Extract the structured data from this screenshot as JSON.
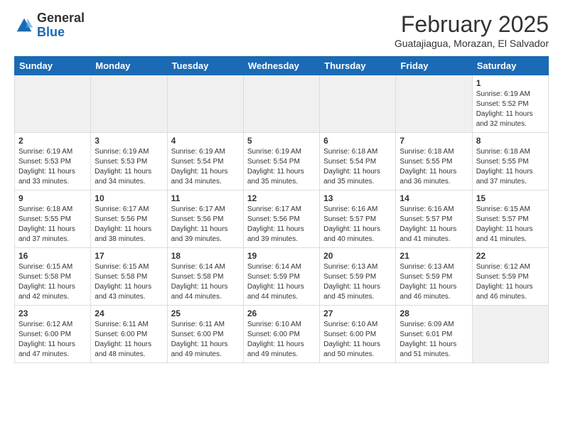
{
  "logo": {
    "general": "General",
    "blue": "Blue"
  },
  "header": {
    "month": "February 2025",
    "location": "Guatajiagua, Morazan, El Salvador"
  },
  "weekdays": [
    "Sunday",
    "Monday",
    "Tuesday",
    "Wednesday",
    "Thursday",
    "Friday",
    "Saturday"
  ],
  "weeks": [
    [
      {
        "day": "",
        "info": ""
      },
      {
        "day": "",
        "info": ""
      },
      {
        "day": "",
        "info": ""
      },
      {
        "day": "",
        "info": ""
      },
      {
        "day": "",
        "info": ""
      },
      {
        "day": "",
        "info": ""
      },
      {
        "day": "1",
        "info": "Sunrise: 6:19 AM\nSunset: 5:52 PM\nDaylight: 11 hours and 32 minutes."
      }
    ],
    [
      {
        "day": "2",
        "info": "Sunrise: 6:19 AM\nSunset: 5:53 PM\nDaylight: 11 hours and 33 minutes."
      },
      {
        "day": "3",
        "info": "Sunrise: 6:19 AM\nSunset: 5:53 PM\nDaylight: 11 hours and 34 minutes."
      },
      {
        "day": "4",
        "info": "Sunrise: 6:19 AM\nSunset: 5:54 PM\nDaylight: 11 hours and 34 minutes."
      },
      {
        "day": "5",
        "info": "Sunrise: 6:19 AM\nSunset: 5:54 PM\nDaylight: 11 hours and 35 minutes."
      },
      {
        "day": "6",
        "info": "Sunrise: 6:18 AM\nSunset: 5:54 PM\nDaylight: 11 hours and 35 minutes."
      },
      {
        "day": "7",
        "info": "Sunrise: 6:18 AM\nSunset: 5:55 PM\nDaylight: 11 hours and 36 minutes."
      },
      {
        "day": "8",
        "info": "Sunrise: 6:18 AM\nSunset: 5:55 PM\nDaylight: 11 hours and 37 minutes."
      }
    ],
    [
      {
        "day": "9",
        "info": "Sunrise: 6:18 AM\nSunset: 5:55 PM\nDaylight: 11 hours and 37 minutes."
      },
      {
        "day": "10",
        "info": "Sunrise: 6:17 AM\nSunset: 5:56 PM\nDaylight: 11 hours and 38 minutes."
      },
      {
        "day": "11",
        "info": "Sunrise: 6:17 AM\nSunset: 5:56 PM\nDaylight: 11 hours and 39 minutes."
      },
      {
        "day": "12",
        "info": "Sunrise: 6:17 AM\nSunset: 5:56 PM\nDaylight: 11 hours and 39 minutes."
      },
      {
        "day": "13",
        "info": "Sunrise: 6:16 AM\nSunset: 5:57 PM\nDaylight: 11 hours and 40 minutes."
      },
      {
        "day": "14",
        "info": "Sunrise: 6:16 AM\nSunset: 5:57 PM\nDaylight: 11 hours and 41 minutes."
      },
      {
        "day": "15",
        "info": "Sunrise: 6:15 AM\nSunset: 5:57 PM\nDaylight: 11 hours and 41 minutes."
      }
    ],
    [
      {
        "day": "16",
        "info": "Sunrise: 6:15 AM\nSunset: 5:58 PM\nDaylight: 11 hours and 42 minutes."
      },
      {
        "day": "17",
        "info": "Sunrise: 6:15 AM\nSunset: 5:58 PM\nDaylight: 11 hours and 43 minutes."
      },
      {
        "day": "18",
        "info": "Sunrise: 6:14 AM\nSunset: 5:58 PM\nDaylight: 11 hours and 44 minutes."
      },
      {
        "day": "19",
        "info": "Sunrise: 6:14 AM\nSunset: 5:59 PM\nDaylight: 11 hours and 44 minutes."
      },
      {
        "day": "20",
        "info": "Sunrise: 6:13 AM\nSunset: 5:59 PM\nDaylight: 11 hours and 45 minutes."
      },
      {
        "day": "21",
        "info": "Sunrise: 6:13 AM\nSunset: 5:59 PM\nDaylight: 11 hours and 46 minutes."
      },
      {
        "day": "22",
        "info": "Sunrise: 6:12 AM\nSunset: 5:59 PM\nDaylight: 11 hours and 46 minutes."
      }
    ],
    [
      {
        "day": "23",
        "info": "Sunrise: 6:12 AM\nSunset: 6:00 PM\nDaylight: 11 hours and 47 minutes."
      },
      {
        "day": "24",
        "info": "Sunrise: 6:11 AM\nSunset: 6:00 PM\nDaylight: 11 hours and 48 minutes."
      },
      {
        "day": "25",
        "info": "Sunrise: 6:11 AM\nSunset: 6:00 PM\nDaylight: 11 hours and 49 minutes."
      },
      {
        "day": "26",
        "info": "Sunrise: 6:10 AM\nSunset: 6:00 PM\nDaylight: 11 hours and 49 minutes."
      },
      {
        "day": "27",
        "info": "Sunrise: 6:10 AM\nSunset: 6:00 PM\nDaylight: 11 hours and 50 minutes."
      },
      {
        "day": "28",
        "info": "Sunrise: 6:09 AM\nSunset: 6:01 PM\nDaylight: 11 hours and 51 minutes."
      },
      {
        "day": "",
        "info": ""
      }
    ]
  ]
}
